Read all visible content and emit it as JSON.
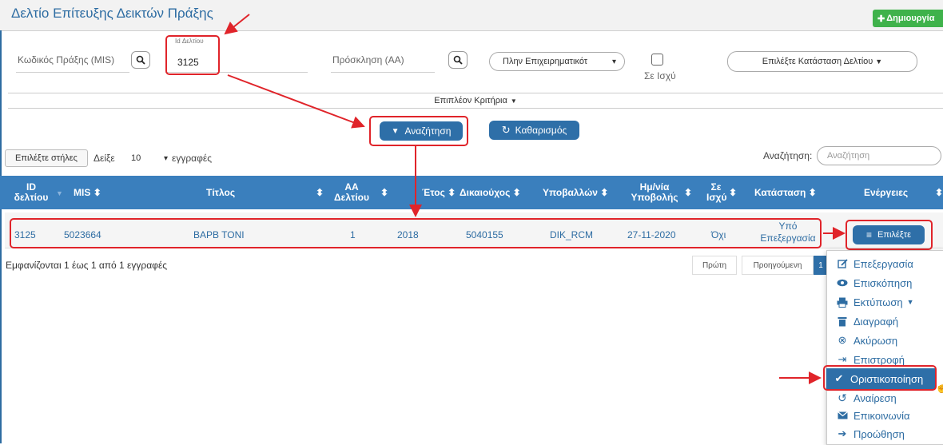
{
  "header": {
    "title": "Δελτίο Επίτευξης Δεικτών Πράξης",
    "create_label": "Δημιουργία"
  },
  "filters": {
    "mis_placeholder": "Κωδικός Πράξης (MIS)",
    "id_label": "Id Δελτίου",
    "id_value": "3125",
    "invitation_placeholder": "Πρόσκληση (ΑΑ)",
    "program_select": "Πλην Επιχειρηματικότ",
    "in_force_label": "Σε Ισχύ",
    "status_select": "Επιλέξτε Κατάσταση Δελτίου",
    "more_criteria": "Επιπλέον Κριτήρια"
  },
  "actions": {
    "search_label": "Αναζήτηση",
    "clear_label": "Καθαρισμός"
  },
  "table_controls": {
    "choose_columns": "Επιλέξτε στήλες",
    "show_label": "Δείξε",
    "page_size": "10",
    "records_label": "εγγραφές",
    "search_label": "Αναζήτηση:",
    "search_placeholder": "Αναζήτηση"
  },
  "table": {
    "columns": {
      "id_l1": "ID",
      "id_l2": "δελτίου",
      "mis": "MIS",
      "title": "Τίτλος",
      "aa_l1": "ΑΑ",
      "aa_l2": "Δελτίου",
      "year": "Έτος",
      "beneficiary": "Δικαιούχος",
      "submitter": "Υποβαλλών",
      "date_l1": "Ημ/νία",
      "date_l2": "Υποβολής",
      "inforce_l1": "Σε",
      "inforce_l2": "Ισχύ",
      "status": "Κατάσταση",
      "actions": "Ενέργειες"
    },
    "row": {
      "id": "3125",
      "mis": "5023664",
      "title": "BAPB TONI",
      "aa": "1",
      "year": "2018",
      "beneficiary": "5040155",
      "submitter": "DIK_RCM",
      "date": "27-11-2020",
      "inforce": "Όχι",
      "status_l1": "Υπό",
      "status_l2": "Επεξεργασία",
      "select_label": "Επιλέξτε"
    }
  },
  "footer": {
    "info": "Εμφανίζονται 1 έως 1 από 1 εγγραφές",
    "first": "Πρώτη",
    "previous": "Προηγούμενη",
    "page": "1"
  },
  "menu": {
    "items": [
      {
        "label": "Επεξεργασία",
        "icon": "edit-icon"
      },
      {
        "label": "Επισκόπηση",
        "icon": "eye-icon"
      },
      {
        "label": "Εκτύπωση",
        "icon": "print-icon"
      },
      {
        "label": "Διαγραφή",
        "icon": "trash-icon"
      },
      {
        "label": "Ακύρωση",
        "icon": "cancel-icon"
      },
      {
        "label": "Επιστροφή",
        "icon": "return-icon"
      },
      {
        "label": "Οριστικοποίηση",
        "icon": "check-circle-icon"
      },
      {
        "label": "Αναίρεση",
        "icon": "undo-icon"
      },
      {
        "label": "Επικοινωνία",
        "icon": "mail-icon"
      },
      {
        "label": "Προώθηση",
        "icon": "forward-arrow-icon"
      }
    ]
  },
  "colors": {
    "accent": "#2e6fa8",
    "header": "#3a7fbd",
    "annotation": "#e0242a",
    "create": "#3fb24b"
  }
}
